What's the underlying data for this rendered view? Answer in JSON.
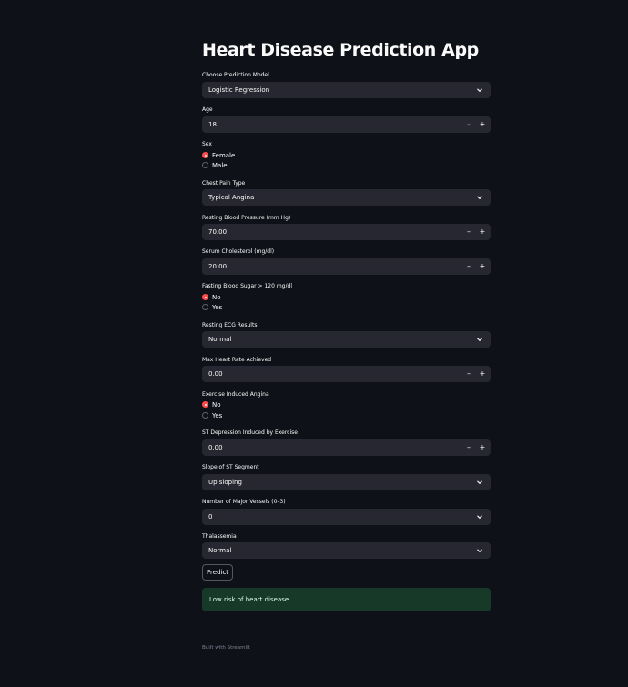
{
  "title": "Heart Disease Prediction App",
  "model": {
    "label": "Choose Prediction Model",
    "value": "Logistic Regression"
  },
  "age": {
    "label": "Age",
    "value": "18"
  },
  "sex": {
    "label": "Sex",
    "options": [
      "Female",
      "Male"
    ],
    "selected": "Female"
  },
  "chest_pain": {
    "label": "Chest Pain Type",
    "value": "Typical Angina"
  },
  "resting_bp": {
    "label": "Resting Blood Pressure (mm Hg)",
    "value": "70.00"
  },
  "cholesterol": {
    "label": "Serum Cholesterol (mg/dl)",
    "value": "20.00"
  },
  "fasting_bs": {
    "label": "Fasting Blood Sugar > 120 mg/dl",
    "options": [
      "No",
      "Yes"
    ],
    "selected": "No"
  },
  "resting_ecg": {
    "label": "Resting ECG Results",
    "value": "Normal"
  },
  "max_hr": {
    "label": "Max Heart Rate Achieved",
    "value": "0.00"
  },
  "exercise_angina": {
    "label": "Exercise Induced Angina",
    "options": [
      "No",
      "Yes"
    ],
    "selected": "No"
  },
  "st_depression": {
    "label": "ST Depression Induced by Exercise",
    "value": "0.00"
  },
  "slope": {
    "label": "Slope of ST Segment",
    "value": "Up sloping"
  },
  "vessels": {
    "label": "Number of Major Vessels (0–3)",
    "value": "0"
  },
  "thalassemia": {
    "label": "Thalassemia",
    "value": "Normal"
  },
  "predict_button": "Predict",
  "result": "Low risk of heart disease",
  "footer": "Built with Streamlit",
  "colors": {
    "background": "#0e1117",
    "input": "#262730",
    "accent": "#ff4b4b",
    "success_bg": "#173928"
  }
}
